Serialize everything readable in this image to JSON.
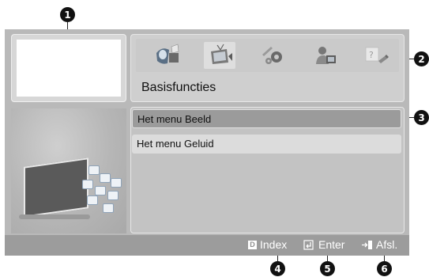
{
  "callouts": [
    "1",
    "2",
    "3",
    "4",
    "5",
    "6"
  ],
  "icons": [
    {
      "name": "picture-menu-icon"
    },
    {
      "name": "tv-channel-icon",
      "selected": true
    },
    {
      "name": "setup-gears-icon"
    },
    {
      "name": "support-icon"
    },
    {
      "name": "help-icon"
    }
  ],
  "menu_title": "Basisfuncties",
  "menu_items": [
    {
      "label": "Het menu Beeld",
      "selected": true
    },
    {
      "label": "Het menu Geluid",
      "selected": false
    }
  ],
  "bottom_bar": {
    "index_key": "D",
    "index_label": "Index",
    "enter_label": "Enter",
    "exit_label": "Afsl."
  }
}
